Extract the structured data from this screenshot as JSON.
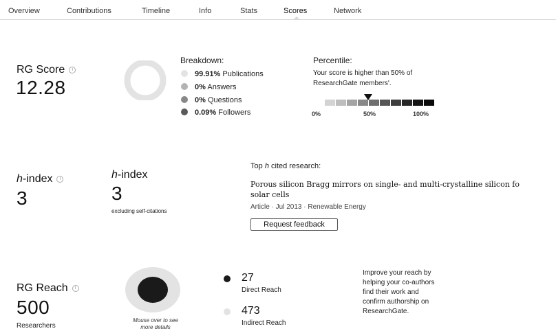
{
  "tabs": [
    {
      "label": "Overview"
    },
    {
      "label": "Contributions"
    },
    {
      "label": "Timeline"
    },
    {
      "label": "Info"
    },
    {
      "label": "Stats"
    },
    {
      "label": "Scores"
    },
    {
      "label": "Network"
    }
  ],
  "active_tab": "Scores",
  "rg_score": {
    "title": "RG Score",
    "info_icon": "info-icon",
    "value": "12.28",
    "breakdown_title": "Breakdown:",
    "breakdown": [
      {
        "percent": "99.91%",
        "label": "Publications",
        "color": "#e3e3e3"
      },
      {
        "percent": "0%",
        "label": "Answers",
        "color": "#b3b3b3"
      },
      {
        "percent": "0%",
        "label": "Questions",
        "color": "#888888"
      },
      {
        "percent": "0.09%",
        "label": "Followers",
        "color": "#5a5a5a"
      }
    ],
    "percentile_title": "Percentile:",
    "percentile_text_1": "Your score is higher than 50% of",
    "percentile_text_2": "ResearchGate members'.",
    "percentile_value": 50,
    "percentile_labels": [
      "0%",
      "50%",
      "100%"
    ],
    "percentile_colors": [
      "#d3d3d3",
      "#bdbdbd",
      "#a4a4a4",
      "#888888",
      "#6e6e6e",
      "#555555",
      "#3d3d3d",
      "#262626",
      "#141414",
      "#0a0a0a"
    ]
  },
  "h_index": {
    "title_italic": "h",
    "title_rest": "-index",
    "value": "3",
    "excluding_title_italic": "h",
    "excluding_title_rest": "-index",
    "excluding_value": "3",
    "excluding_caption": "excluding self-citations",
    "top_cited_prefix": "Top",
    "top_cited_italic": "h",
    "top_cited_suffix": "cited research:",
    "paper_title_line1": "Porous silicon Bragg mirrors on single- and multi-crystalline silicon fo",
    "paper_title_line2": "solar cells",
    "paper_meta": "Article · Jul 2013 · Renewable Energy",
    "request_feedback": "Request feedback"
  },
  "rg_reach": {
    "title": "RG Reach",
    "value": "500",
    "unit": "Researchers",
    "mouse_over_1": "Mouse over to see",
    "mouse_over_2": "more details",
    "direct_value": "27",
    "direct_label": "Direct Reach",
    "direct_color": "#1a1a1a",
    "indirect_value": "473",
    "indirect_label": "Indirect Reach",
    "indirect_color": "#e3e3e3",
    "improve_1": "Improve your reach by",
    "improve_2": "helping your co-authors",
    "improve_3": "find their work and",
    "improve_4": "confirm authorship on",
    "improve_5": "ResearchGate."
  }
}
